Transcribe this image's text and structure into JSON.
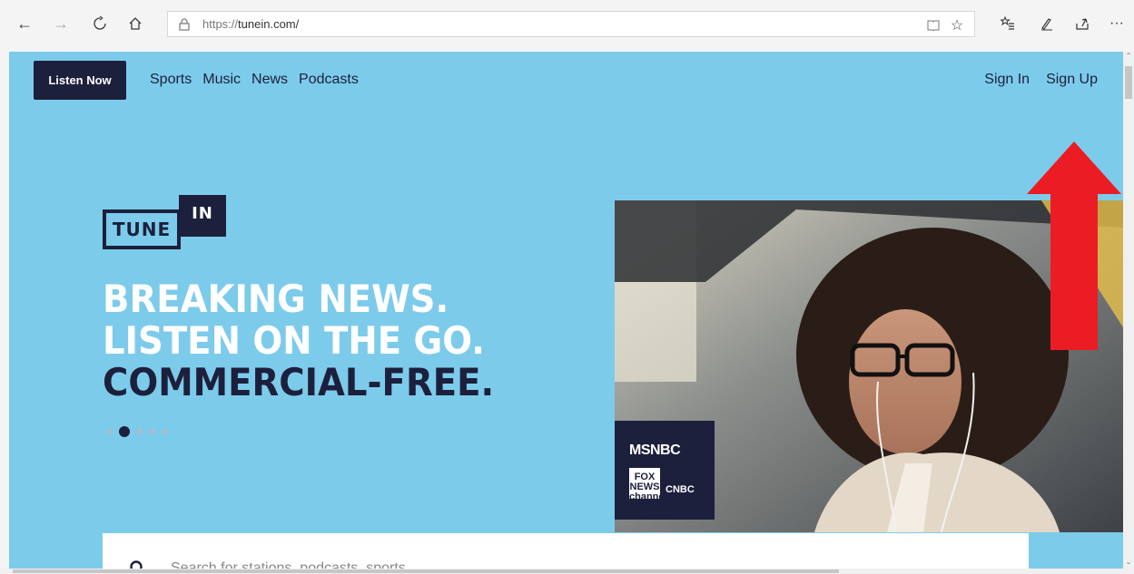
{
  "browser": {
    "url_protocol": "https://",
    "url_host": "tunein.com/",
    "icons": [
      "back-icon",
      "forward-icon",
      "refresh-icon",
      "home-icon",
      "lock-icon",
      "reading-view-icon",
      "favorite-star-icon",
      "favorites-list-icon",
      "pen-icon",
      "share-icon",
      "more-icon"
    ]
  },
  "nav": {
    "listen_now": "Listen Now",
    "links": [
      "Sports",
      "Music",
      "News",
      "Podcasts"
    ],
    "sign_in": "Sign In",
    "sign_up": "Sign Up"
  },
  "logo": {
    "left": "TUNE",
    "right": "IN"
  },
  "hero": {
    "line1": "BREAKING NEWS.",
    "line2": "LISTEN ON THE GO.",
    "line3": "COMMERCIAL-FREE.",
    "carousel_active_index": 1,
    "carousel_count": 5
  },
  "brands": {
    "msnbc": "MSNBC",
    "fox": "FOX NEWS channel",
    "cnbc": "CNBC"
  },
  "search": {
    "placeholder": "Search for stations, podcasts, sports"
  },
  "colors": {
    "hero_bg": "#7dcbeb",
    "navy": "#1c203c",
    "arrow_red": "#ec1c24"
  }
}
